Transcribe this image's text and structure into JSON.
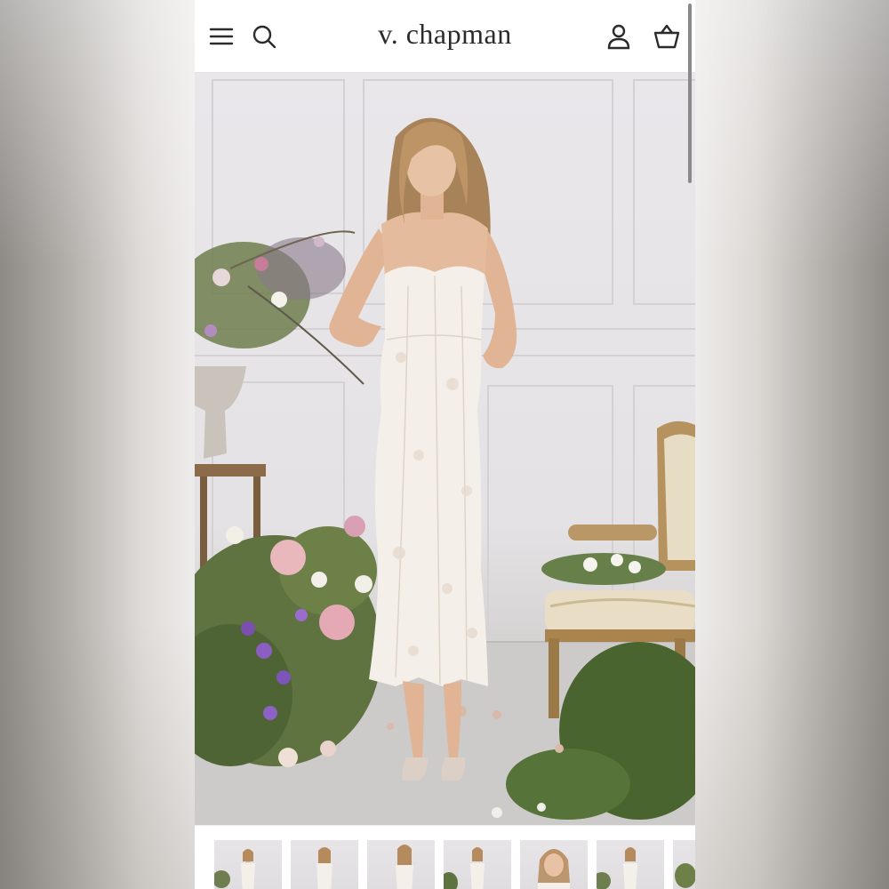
{
  "header": {
    "brand": "v. chapman",
    "menu_icon": "hamburger-menu-icon",
    "search_icon": "search-icon",
    "account_icon": "user-account-icon",
    "cart_icon": "shopping-basket-icon"
  },
  "hero": {
    "image": "model-in-white-lace-midi-dress-with-flowers-and-armchair"
  },
  "gallery": {
    "thumbnails": [
      "product-thumbnail-1",
      "product-thumbnail-2",
      "product-thumbnail-3",
      "product-thumbnail-4",
      "product-thumbnail-5",
      "product-thumbnail-6",
      "product-thumbnail-7"
    ]
  },
  "colors": {
    "header_bg": "#ffffff",
    "text": "#2b2b2b",
    "dress": "#f4efe9",
    "hair": "#b58a5c",
    "skin": "#e3b999"
  }
}
